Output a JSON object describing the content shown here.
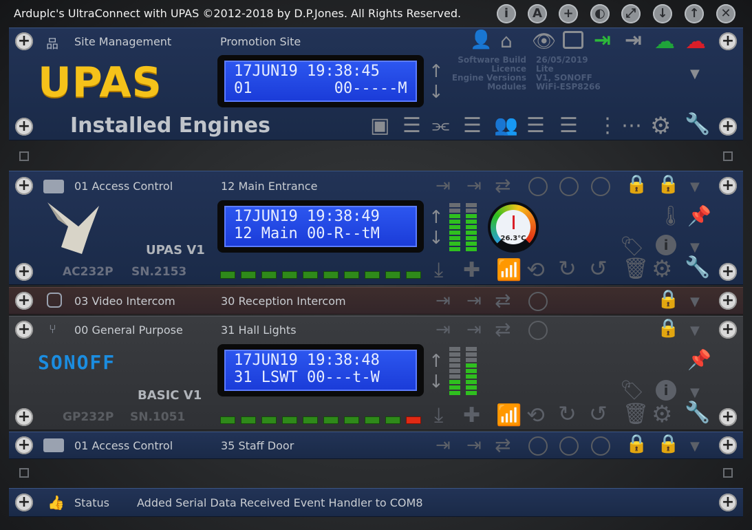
{
  "window": {
    "title": "Arduplc's UltraConnect with UPAS ©2012-2018 by D.P.Jones. All Rights Reserved."
  },
  "titlebar_buttons": [
    "info-icon",
    "font-icon",
    "add-icon",
    "contrast-icon",
    "resize-icon",
    "down-icon",
    "up-icon",
    "close-icon"
  ],
  "site": {
    "label": "Site Management",
    "name": "Promotion Site",
    "logo": "UPAS",
    "heading": "Installed Engines",
    "lcd_line1": "17JUN19 19:38:45",
    "lcd_line2": "01         00-----M",
    "info": [
      {
        "key": "Software Build",
        "val": "26/05/2019"
      },
      {
        "key": "Licence",
        "val": "Lite"
      },
      {
        "key": "Engine Versions",
        "val": "V1, SONOFF"
      },
      {
        "key": "Modules",
        "val": "WiFi-ESP8266"
      }
    ]
  },
  "engine1": {
    "category": "01 Access Control",
    "name": "12 Main Entrance",
    "model": "UPAS V1",
    "serial_left": "AC232P",
    "serial_right": "SN.2153",
    "lcd_line1": "17JUN19 19:38:49",
    "lcd_line2": "12 Main 00-R--tM",
    "temperature": "26.3°C"
  },
  "engine2": {
    "category": "03 Video Intercom",
    "name": "30 Reception Intercom"
  },
  "engine3": {
    "category": "00 General Purpose",
    "name": "31 Hall Lights",
    "logo": "SONOFF",
    "model": "BASIC V1",
    "serial_left": "GP232P",
    "serial_right": "SN.1051",
    "lcd_line1": "17JUN19 19:38:48",
    "lcd_line2": "31 LSWT 00---t-W"
  },
  "engine4": {
    "category": "01 Access Control",
    "name": "35 Staff Door"
  },
  "status": {
    "label": "Status",
    "message": "Added Serial Data Received Event Handler to COM8"
  },
  "colors": {
    "accent_blue": "#2d57f0",
    "led_green": "#2f8a1a",
    "led_red": "#e02a14",
    "logo_yellow": "#f5c21a"
  }
}
